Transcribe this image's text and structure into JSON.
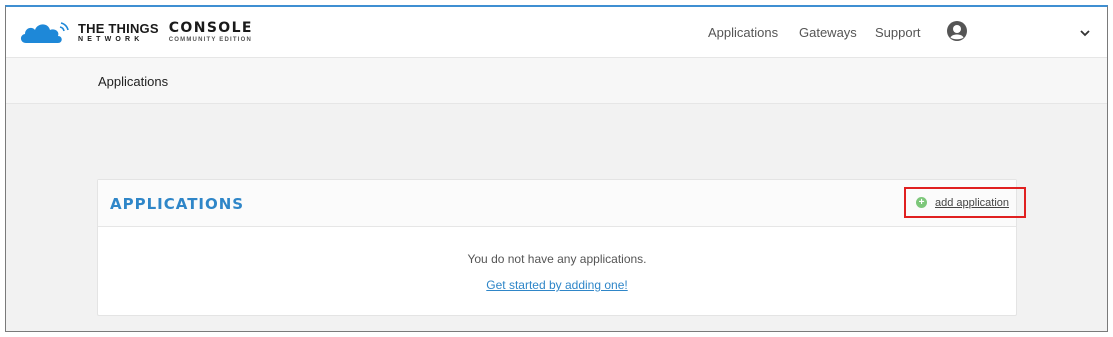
{
  "header": {
    "brand_name": "THE THINGS",
    "brand_sub": "NETWORK",
    "console_title": "CONSOLE",
    "console_sub": "COMMUNITY EDITION",
    "nav": {
      "applications": "Applications",
      "gateways": "Gateways",
      "support": "Support"
    },
    "icons": {
      "logo": "cloud-logo-icon",
      "avatar": "user-avatar-icon",
      "caret": "chevron-down-icon"
    }
  },
  "breadcrumb": {
    "current": "Applications"
  },
  "applications_card": {
    "title": "APPLICATIONS",
    "add_label": "add application",
    "empty_message": "You do not have any applications.",
    "empty_cta": "Get started by adding one!"
  },
  "colors": {
    "accent": "#2f86c8",
    "highlight": "#e02020",
    "add_icon": "#7dc77a"
  }
}
